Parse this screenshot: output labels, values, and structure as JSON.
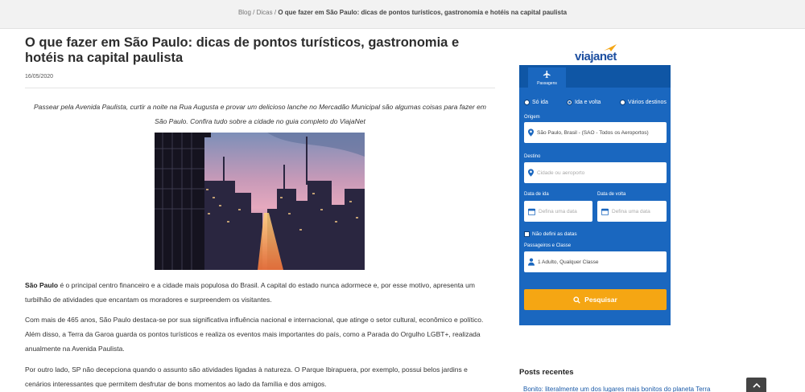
{
  "breadcrumb": {
    "blog": "Blog",
    "sep1": " / ",
    "dicas": "Dicas",
    "sep2": " / ",
    "current": "O que fazer em São Paulo: dicas de pontos turísticos, gastronomia e hotéis na capital paulista"
  },
  "article": {
    "title": "O que fazer em São Paulo: dicas de pontos turísticos, gastronomia e hotéis na capital paulista",
    "date": "16/05/2020",
    "intro": "Passear pela Avenida Paulista, curtir a noite na Rua Augusta e provar um delicioso lanche no Mercadão Municipal são algumas coisas para fazer em São Paulo. Confira tudo sobre a cidade no guia completo do ViajaNet",
    "p1_bold": "São Paulo",
    "p1_rest": " é o principal centro financeiro e a cidade mais populosa do Brasil. A capital do estado nunca adormece e, por esse motivo, apresenta um turbilhão de atividades que encantam os moradores e surpreendem os visitantes.",
    "p2": "Com mais de 465 anos, São Paulo destaca-se por sua significativa influência nacional e internacional, que atinge o setor cultural, econômico e político. Além disso, a Terra da Garoa guarda os pontos turísticos e realiza os eventos mais importantes do país, como a Parada do Orgulho LGBT+, realizada anualmente na Avenida Paulista.",
    "p3": "Por outro lado, SP não decepciona quando o assunto são atividades ligadas à natureza. O Parque Ibirapuera, por exemplo, possui belos jardins e cenários interessantes que permitem desfrutar de bons momentos ao lado da família e dos amigos."
  },
  "widget": {
    "logo": "viajanet",
    "tab_label": "Passagens",
    "trip_options": [
      "Só ida",
      "Ida e volta",
      "Vários destinos"
    ],
    "selected_trip": "Ida e volta",
    "origin_label": "Origem",
    "origin_value": "São Paulo, Brasil - (SAO - Todos os Aeroportos)",
    "destination_label": "Destino",
    "destination_placeholder": "Cidade ou aeroporto",
    "depart_label": "Data de ida",
    "depart_placeholder": "Defina uma data",
    "return_label": "Data de volta",
    "return_placeholder": "Defina uma data",
    "no_dates_label": "Não defini as datas",
    "passengers_label": "Passageiros e Classe",
    "passengers_value": "1 Adulto, Qualquer Classe",
    "search_label": "Pesquisar"
  },
  "sidebar": {
    "recent_title": "Posts recentes",
    "recent_item": "Bonito: literalmente um dos lugares mais bonitos do planeta Terra"
  },
  "colors": {
    "widget_blue": "#1a67bf",
    "widget_dark_blue": "#0f56a5",
    "search_orange": "#f5a613",
    "logo_blue": "#1d4fa0"
  }
}
